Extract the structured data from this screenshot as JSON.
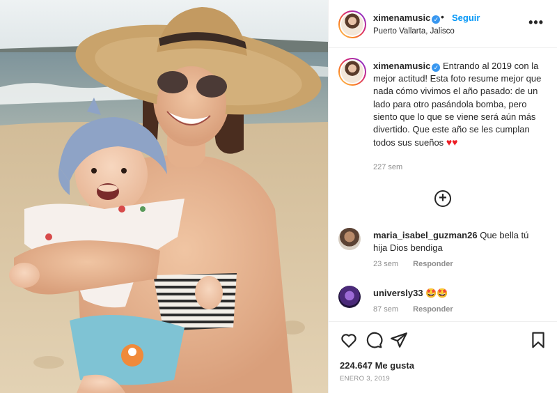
{
  "post": {
    "username": "ximenamusic",
    "follow_label": "Seguir",
    "location": "Puerto Vallarta, Jalisco",
    "more_icon": "more-options-icon",
    "verified_icon": "verified-badge-icon"
  },
  "caption": {
    "username": "ximenamusic",
    "text": "Entrando al 2019 con la mejor actitud! Esta foto resume mejor que nada cómo vivimos el año pasado: de un lado para otro pasándola bomba, pero siento que lo que se viene será aún más divertido. Que este año se les cumplan todos sus sueños",
    "hearts": "♥♥",
    "time": "227 sem"
  },
  "load_more_icon": "plus-circle-icon",
  "comments": [
    {
      "username": "maria_isabel_guzman26",
      "text": "Que bella tú hija Dios bendiga",
      "time": "23 sem",
      "reply_label": "Responder"
    },
    {
      "username": "universly33",
      "text": "🤩🤩",
      "time": "87 sem",
      "reply_label": "Responder"
    }
  ],
  "actions": {
    "icons": [
      "heart-icon",
      "comment-icon",
      "share-icon",
      "bookmark-icon"
    ],
    "likes": "224.647 Me gusta",
    "date": "ENERO 3, 2019"
  },
  "colors": {
    "accent": "#0095f6",
    "text": "#262626",
    "muted": "#8e8e8e",
    "border": "#efefef",
    "heart": "#ed1c24"
  }
}
